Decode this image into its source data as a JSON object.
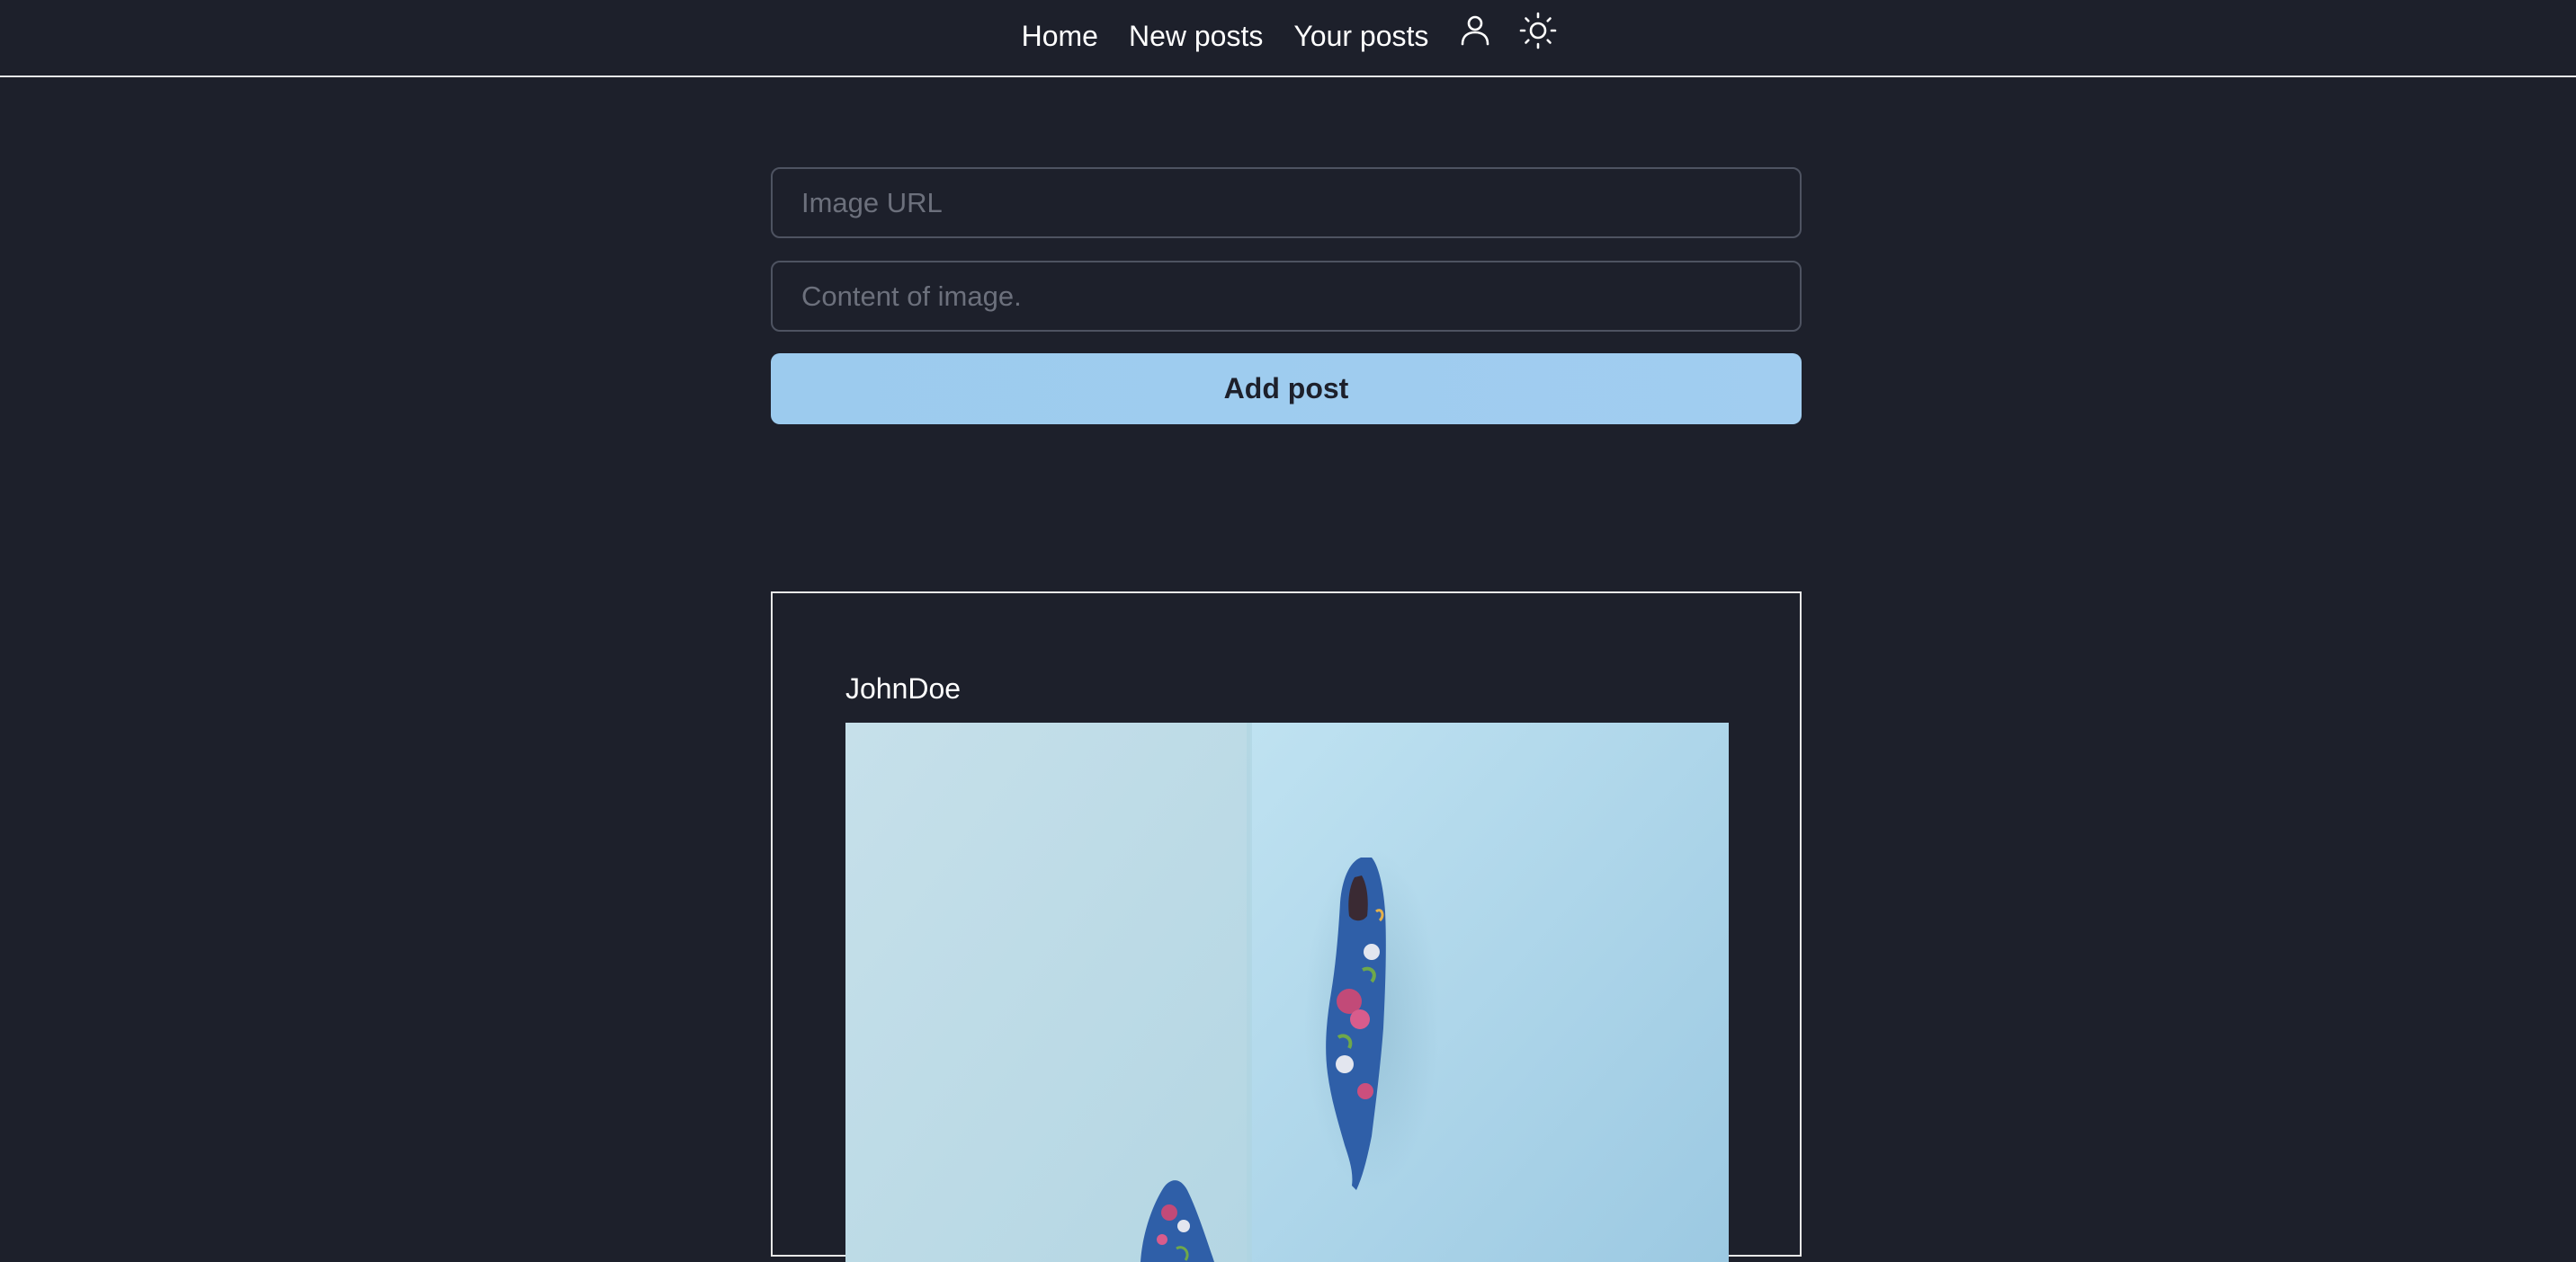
{
  "nav": {
    "links": [
      "Home",
      "New posts",
      "Your posts"
    ],
    "icons": [
      "user-icon",
      "sun-icon"
    ]
  },
  "form": {
    "image_url_placeholder": "Image URL",
    "content_placeholder": "Content of image.",
    "submit_label": "Add post"
  },
  "post": {
    "author": "JohnDoe",
    "image_subject": "blue floral high-heel shoes on light blue background"
  },
  "colors": {
    "background": "#1d202b",
    "accent": "#9ccbee",
    "border": "#4e5361"
  }
}
